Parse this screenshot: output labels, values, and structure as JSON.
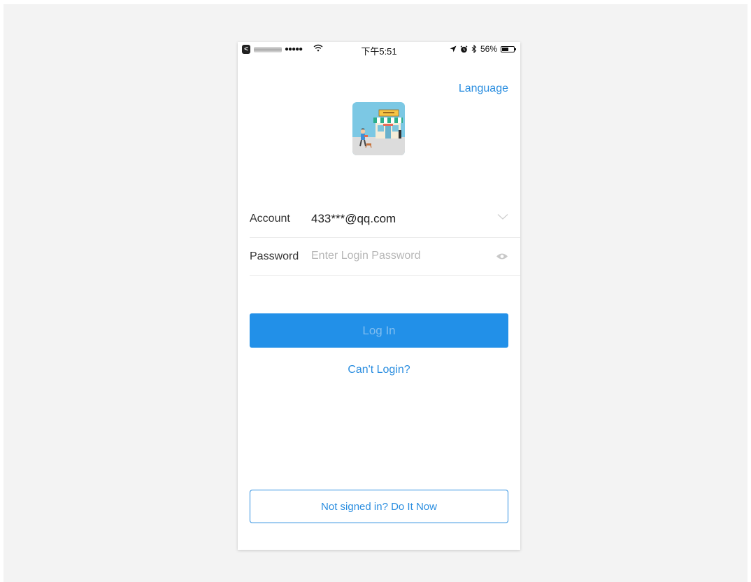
{
  "status_bar": {
    "back_glyph": "<",
    "signal": "●●●●●",
    "time": "下午5:51",
    "battery_percent": "56%",
    "battery_level": 0.56
  },
  "header": {
    "language_label": "Language"
  },
  "form": {
    "account_label": "Account",
    "account_value": "433***@qq.com",
    "password_label": "Password",
    "password_placeholder": "Enter Login Password"
  },
  "actions": {
    "login_label": "Log In",
    "cant_login_label": "Can't Login?",
    "signup_label": "Not signed in?  Do It Now"
  },
  "colors": {
    "accent": "#2b8ee0",
    "primary_button": "#2290e8",
    "backdrop": "#f3f3f3"
  },
  "icons": {
    "wifi": "wifi-icon",
    "location": "location-arrow-icon",
    "alarm": "alarm-icon",
    "bluetooth": "bluetooth-icon",
    "battery": "battery-icon",
    "dropdown": "chevron-down-icon",
    "password_visibility": "eye-icon",
    "logo": "store-logo-icon"
  }
}
